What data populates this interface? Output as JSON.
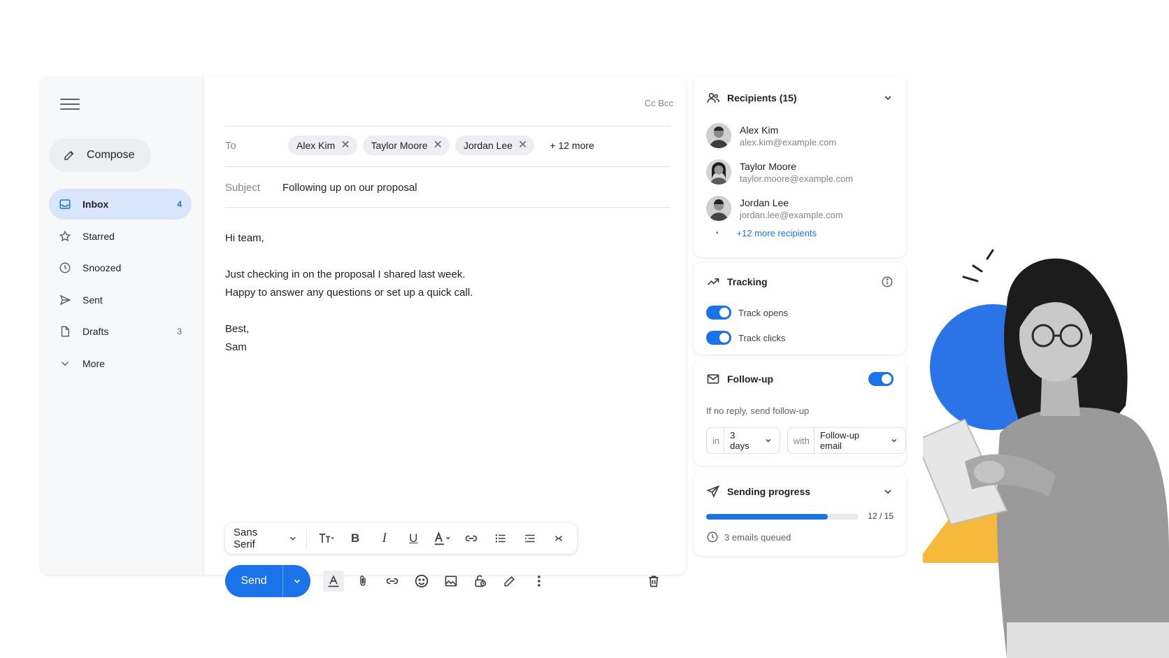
{
  "sidebar": {
    "compose_label": "Compose",
    "items": [
      {
        "label": "Inbox",
        "count": "4",
        "icon": "inbox-icon"
      },
      {
        "label": "Starred",
        "count": "",
        "icon": "star-icon"
      },
      {
        "label": "Snoozed",
        "count": "",
        "icon": "clock-icon"
      },
      {
        "label": "Sent",
        "count": "",
        "icon": "send-icon"
      },
      {
        "label": "Drafts",
        "count": "3",
        "icon": "draft-icon"
      },
      {
        "label": "More",
        "count": "",
        "icon": "chevron-down-icon"
      }
    ]
  },
  "compose": {
    "cc_bcc": "Cc Bcc",
    "to_label": "To",
    "recipients": [
      "Alex Kim",
      "Taylor Moore",
      "Jordan Lee"
    ],
    "more_recipients": "+ 12 more",
    "subject_label": "Subject",
    "subject_value": "Following up on our proposal",
    "body": [
      "Hi team,",
      "Just checking in on the proposal I shared last week.",
      "Happy to answer any questions or set up a quick call.",
      "Best,",
      "Sam"
    ],
    "font_name": "Sans Serif",
    "send_label": "Send"
  },
  "recipients_panel": {
    "title": "Recipients (15)",
    "people": [
      {
        "name": "Alex Kim",
        "email": "alex.kim@example.com"
      },
      {
        "name": "Taylor Moore",
        "email": "taylor.moore@example.com"
      },
      {
        "name": "Jordan Lee",
        "email": "jordan.lee@example.com"
      }
    ],
    "more_link": "+12 more recipients"
  },
  "tracking_panel": {
    "title": "Tracking",
    "options": [
      {
        "label": "Track opens",
        "enabled": true
      },
      {
        "label": "Track clicks",
        "enabled": true
      }
    ]
  },
  "followup_panel": {
    "title": "Follow-up",
    "enabled": true,
    "description": "If no reply, send follow-up",
    "delay_prefix": "in",
    "delay_value": "3 days",
    "template_prefix": "with",
    "template_value": "Follow-up email"
  },
  "progress_panel": {
    "title": "Sending progress",
    "sent": 12,
    "total": 15,
    "count_text": "12 / 15",
    "queued_text": "3 emails queued"
  },
  "colors": {
    "accent": "#1a73e8",
    "active_nav": "#d8e5fb",
    "illustration_circle": "#2b74e8",
    "illustration_triangle": "#f6b93b"
  }
}
